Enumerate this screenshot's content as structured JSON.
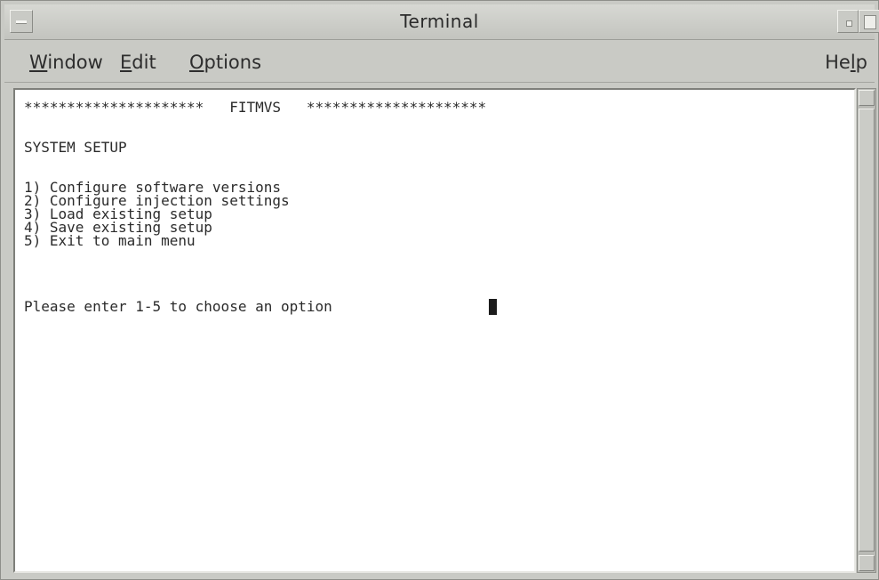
{
  "window": {
    "title": "Terminal"
  },
  "menubar": {
    "window": {
      "mnemonic": "W",
      "rest": "indow"
    },
    "edit": {
      "mnemonic": "E",
      "rest": "dit"
    },
    "options": {
      "mnemonic": "O",
      "rest": "ptions"
    },
    "help": {
      "prefix": "He",
      "mnemonic": "l",
      "rest": "p"
    }
  },
  "terminal": {
    "lines": [
      "*********************   FITMVS   *********************",
      "",
      "SYSTEM SETUP",
      "",
      "1) Configure software versions",
      "2) Configure injection settings",
      "3) Load existing setup",
      "4) Save existing setup",
      "5) Exit to main menu",
      "",
      "Please enter 1-5 to choose an option"
    ]
  },
  "icons": {
    "window_menu": "window-menu-icon",
    "minimize": "minimize-icon",
    "maximize": "maximize-icon",
    "scroll_up": "scroll-up-arrow-icon",
    "scroll_down": "scroll-down-arrow-icon"
  }
}
